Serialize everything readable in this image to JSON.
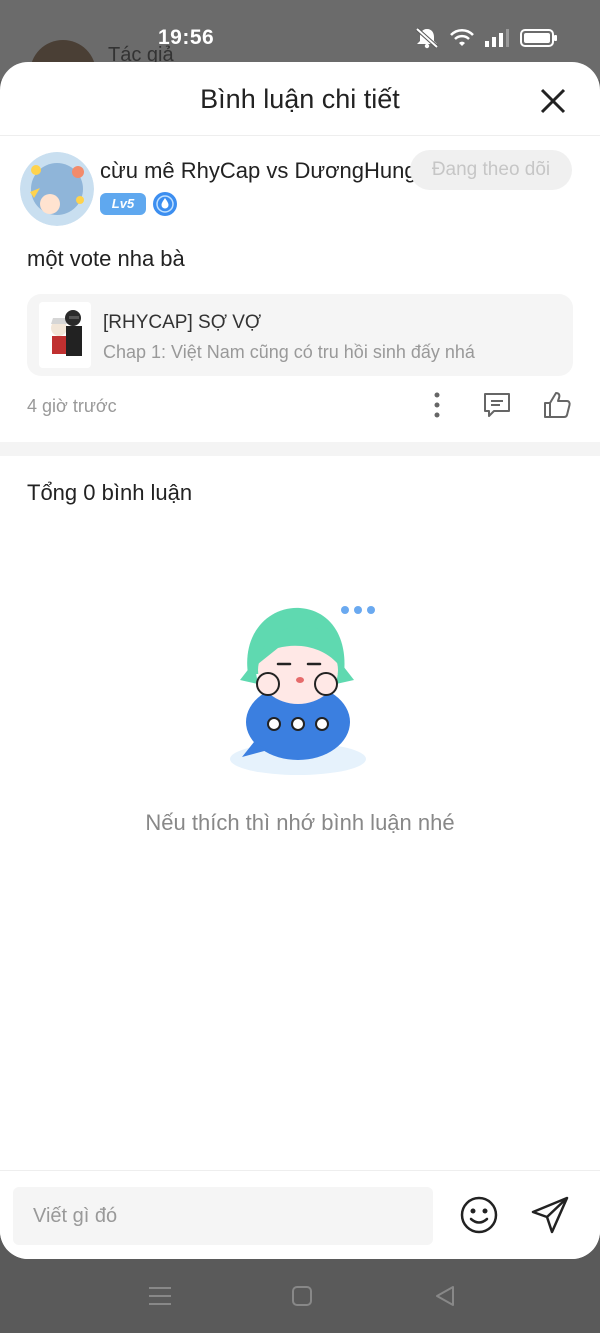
{
  "status_bar": {
    "time": "19:56"
  },
  "background": {
    "author_label": "Tác giả"
  },
  "header": {
    "title": "Bình luận chi tiết"
  },
  "comment": {
    "username": "cừu mê RhyCap vs DươngHung",
    "follow_label": "Đang theo dõi",
    "level": "Lv5",
    "text": "một vote nha bà",
    "reference": {
      "title": "[RHYCAP] SỢ VỢ",
      "subtitle": "Chap 1: Việt Nam cũng có tru hồi sinh đấy nhá"
    },
    "time": "4 giờ trước"
  },
  "total_comments": "Tổng 0 bình luận",
  "empty_state": {
    "message": "Nếu thích thì nhớ bình luận nhé"
  },
  "composer": {
    "placeholder": "Viết gì đó"
  },
  "colors": {
    "accent": "#5fa8ef",
    "mascot_hair": "#5fd9b0",
    "mascot_bubble": "#3b7fe0"
  }
}
